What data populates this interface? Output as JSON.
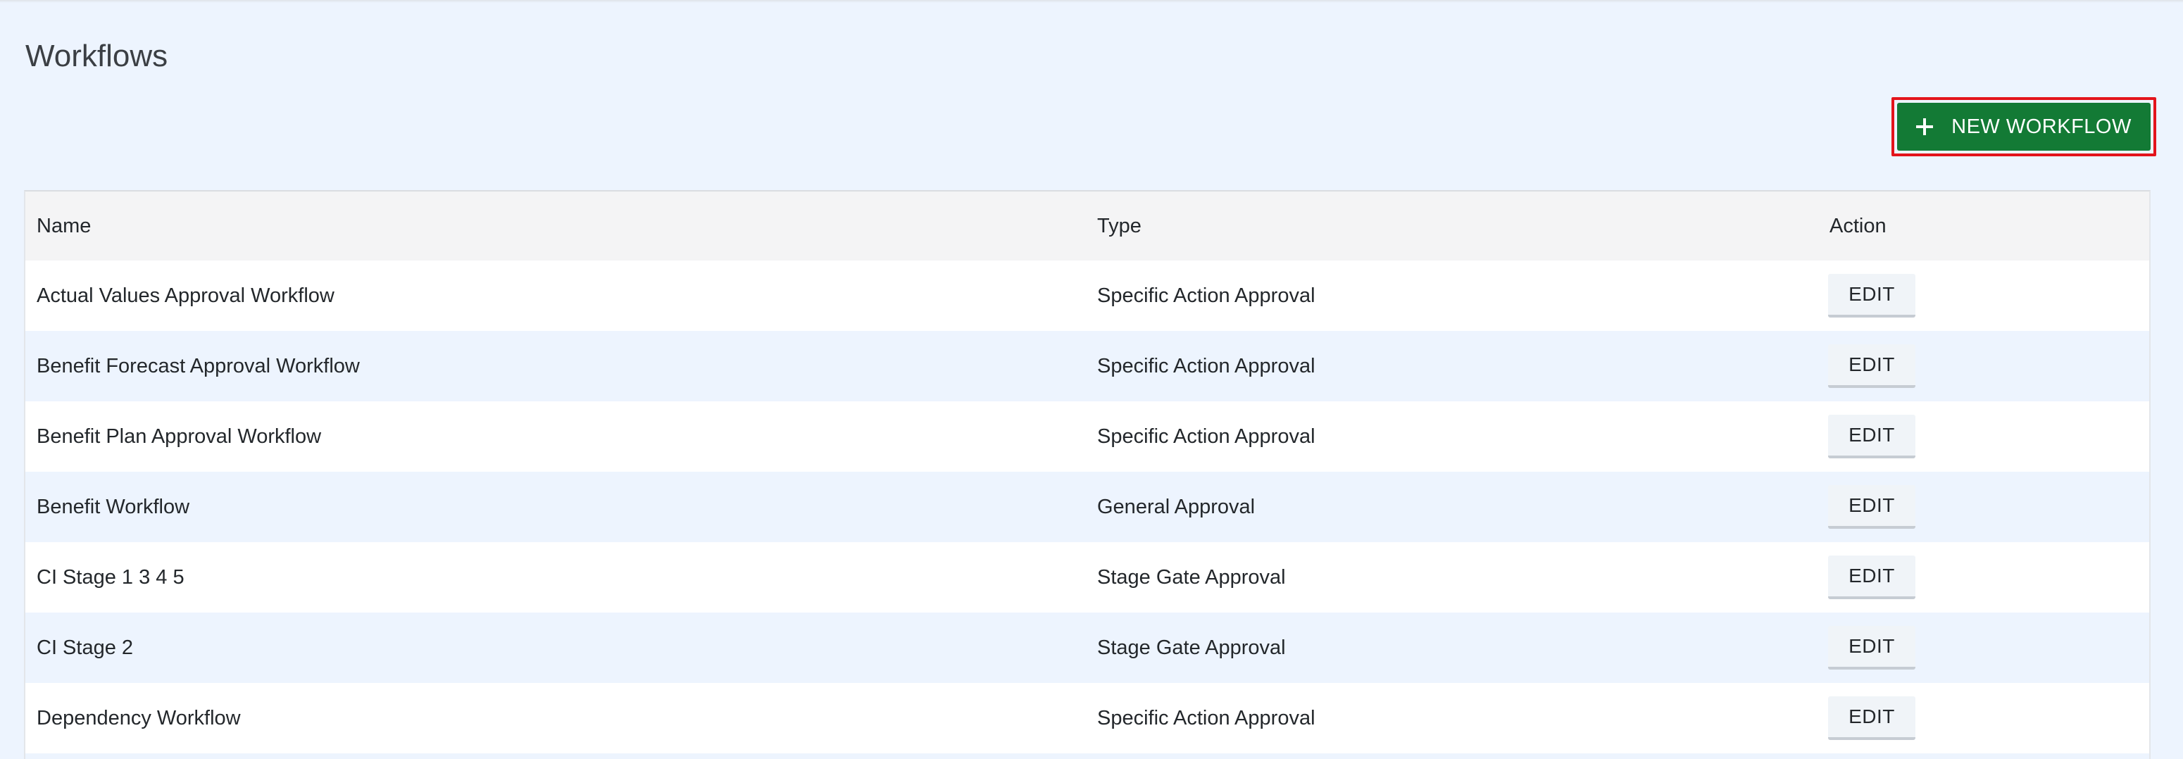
{
  "page": {
    "title": "Workflows"
  },
  "toolbar": {
    "new_button_label": "NEW WORKFLOW",
    "new_button_icon": "plus-icon",
    "new_button_color": "#137a35",
    "highlight_color": "#e3141b"
  },
  "table": {
    "columns": [
      "Name",
      "Type",
      "Action"
    ],
    "rows": [
      {
        "name": "Actual Values Approval Workflow",
        "type": "Specific Action Approval",
        "action": "EDIT"
      },
      {
        "name": "Benefit Forecast Approval Workflow",
        "type": "Specific Action Approval",
        "action": "EDIT"
      },
      {
        "name": "Benefit Plan Approval Workflow",
        "type": "Specific Action Approval",
        "action": "EDIT"
      },
      {
        "name": "Benefit Workflow",
        "type": "General Approval",
        "action": "EDIT"
      },
      {
        "name": "CI Stage 1 3 4 5",
        "type": "Stage Gate Approval",
        "action": "EDIT"
      },
      {
        "name": "CI Stage 2",
        "type": "Stage Gate Approval",
        "action": "EDIT"
      },
      {
        "name": "Dependency Workflow",
        "type": "Specific Action Approval",
        "action": "EDIT"
      }
    ]
  }
}
